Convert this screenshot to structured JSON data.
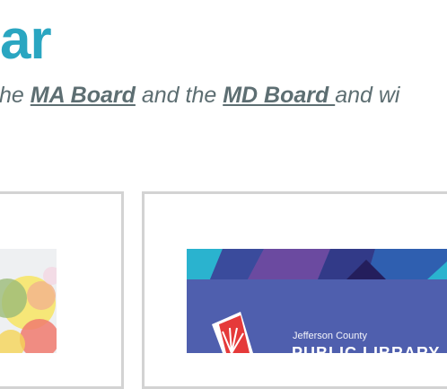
{
  "page": {
    "heading": "ar",
    "subtitle": {
      "prefix": "he ",
      "link1": "MA Board",
      "middle": " and the ",
      "link2": "MD Board ",
      "suffix": "and wi"
    }
  },
  "cards": [
    {
      "name": "left-card-partial"
    },
    {
      "name": "right-card",
      "image_text_line1": "Jefferson County",
      "image_text_line2": "PUBLIC LIBRARY"
    }
  ],
  "colors": {
    "heading": "#2aa6c1",
    "subtitle": "#5d6e72",
    "card_border": "#d3d3d3",
    "library_banner": "#4f5fae"
  }
}
